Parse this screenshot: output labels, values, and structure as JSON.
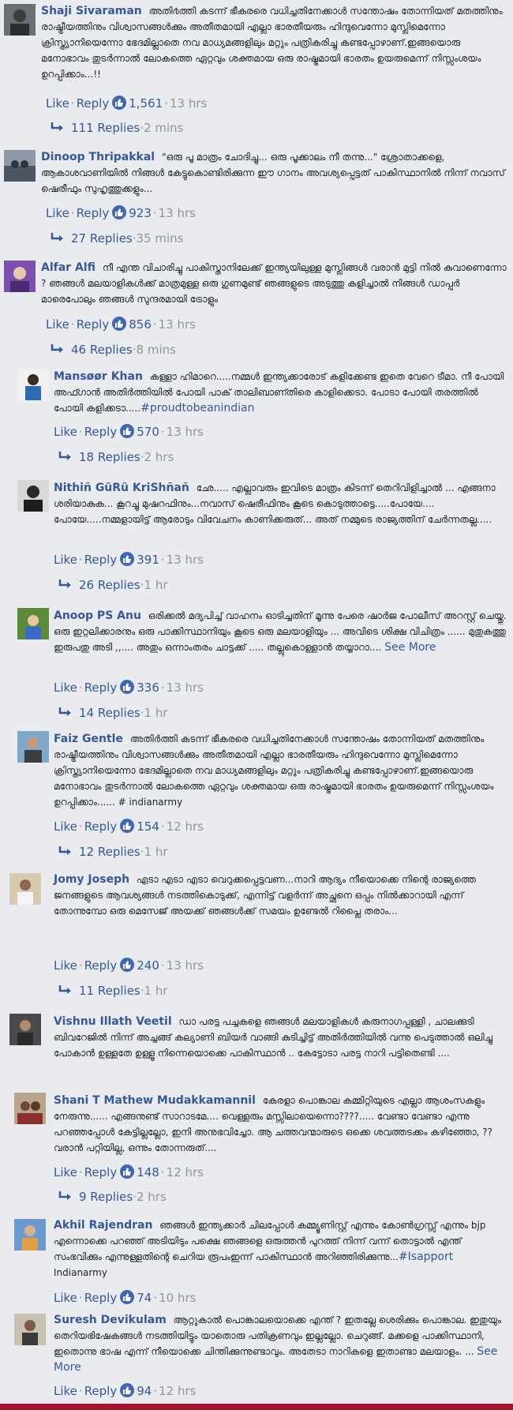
{
  "ui": {
    "like": "Like",
    "reply": "Reply",
    "dot": "·",
    "see_more": "See More"
  },
  "comments": [
    {
      "author": "Shaji Sivaraman",
      "text": "അതി൪ത്തി കടന്ന് ഭീകരരെ വധിച്ചതിനേക്കാൾ സന്തോഷം തോന്നിയത് മതത്തിനും രാഷ്ട്രീയത്തിനും വിശ്വാസങ്ങൾക്കും അതീതമായി എല്ലാ ഭാരതീയരും ഹിന്ദുവെന്നോ മുസ്ലിമെന്നോ ക്രിസ്ത്യാനിയെന്നോ ഭേദമില്ലാതെ നവ മാധ്യമങ്ങളിലും മറ്റും പത്രികരിച്ചു കണ്ടപ്പോഴാണ്.ഇങ്ങയൊരു മനോഭാവം തുടർന്നാൽ ലോകത്തെ ഏറ്റവും ശക്തമായ ഒരു രാഷ്ട്രമായി ഭാരതം ഉയരുമെന്ന് നിസ്സംശയം ഉറപ്പിക്കാം...!!",
      "see_more": "",
      "likes": "1,561",
      "time": "13 hrs",
      "replies": "111 Replies",
      "replies_time": "2 mins"
    },
    {
      "author": "Dinoop Thripakkal",
      "text": "\"ഒരു പൂ മാത്രം ചോദിച്ചു... ഒരു പൂക്കാലം നീ തന്നു...\" ശ്രോതാക്കളെ, ആകാശവാണിയിൽ നിങ്ങൾ കേട്ടുകൊണ്ടിരിക്കുന്ന ഈ ഗാനം അവശ്യപ്പെട്ടത് പാകിസ്ഥാനിൽ നിന്ന് നവാസ് ഷെരീഫും സുഹൃത്തുക്കളും...",
      "see_more": "",
      "likes": "923",
      "time": "13 hrs",
      "replies": "27 Replies",
      "replies_time": "35 mins"
    },
    {
      "author": "Alfar Alfi",
      "text": "നീ എന്ത വിചാരിച്ചു പാകിസ്താനിലേക്ക് ഇന്ത്യയിലുള്ള മുസ്ലിങ്ങൾ വരാൻ മുട്ടി നിൽ കുവാണെന്നോ ? ഞങ്ങൾ മലയാളികൾക്ക് മാത്രമുള്ള ഒരു ഗുണമുണ്ട് ഞങ്ങളുടെ അടുത്തു കളിച്ചാൽ നിങ്ങൾ ഡാപ്പർ മാരെപോലും ഞങ്ങൾ സുന്ദരമായി ട്രോളും",
      "see_more": "",
      "likes": "856",
      "time": "13 hrs",
      "replies": "46 Replies",
      "replies_time": "8 mins"
    },
    {
      "author": "Mansøør Khan",
      "text": "കള്ളാ ഹിമാറെ.....നമ്മൾ ഇന്ത്യക്കാരോട് കളിക്കേണ്ട ഇതെ വേറെ ടീമാ. നീ പോയി അഫ്ഗാൻ അതിർത്തിയിൽ പോയി പാക് താലിബാണ്തിരെ കാളിക്കെടാ. പോടാ പോയി തരത്തിൽ പോയി കളിക്കടാ.....",
      "hashtag": "#proudtobeanindian",
      "see_more": "",
      "likes": "570",
      "time": "13 hrs",
      "replies": "18 Replies",
      "replies_time": "2 hrs"
    },
    {
      "author": "Nithiñ GüRü KriShñañ",
      "text": "ഛേ..... എല്ലാവരും ഇവിടെ മാത്രം കിടന്ന് തെറിവിളിച്ചാൽ ... എങ്ങനാ ശരിയാകുക... കൂറച്ചു മുഷറഫിനും...നവാസ് ഷെരീഫിനും കൂടെ കൊടുത്താട്ടെ.....പോയേ.... പോയേ.....നമ്മളായിട്ട് ആരോടും വിവേചനം കാണിക്കരുത്... അത് നമ്മുടെ രാജ്യത്തിന് ചേർന്നതല്ല.....",
      "see_more": "",
      "likes": "391",
      "time": "13 hrs",
      "replies": "26 Replies",
      "replies_time": "1 hr"
    },
    {
      "author": "Anoop PS Anu",
      "text": "ഒരിക്കൽ മദ്യപിച്ച് വാഹനം ഓടിച്ചതിന് മൂന്നു പേരെ ഷാർജ പോലീസ് അറസ്റ്റ് ചെയ്തു. ഒരു ഇറ്റലിക്കാരനും ഒരു പാക്കിസ്ഥാനിയും കൂടെ ഒരു മലയാളിയും ... അവിടെ ശിക്ഷ വിചിത്രം ...... മുതുകത്തു ഇരുപതു അടി ,,.... അതും ഒന്നാംതരം ചാട്ടക്ക് ..... തല്ലുകൊള്ളാൻ തയ്യാറാ....",
      "see_more": "See More",
      "likes": "336",
      "time": "13 hrs",
      "replies": "14 Replies",
      "replies_time": "1 hr"
    },
    {
      "author": "Faiz Gentle",
      "text": "അതിർത്തി കടന്ന് ഭീകരരെ വധിച്ചതിനേക്കാൾ സന്തോഷം തോന്നിയത് മതത്തിനും രാഷ്ട്രീയത്തിനും വിശ്വാസങ്ങൾക്കും അതീതമായി എല്ലാ ഭാരതീയരും ഹിന്ദുവെന്നോ മുസ്ലിമെന്നോ ക്രിസ്ത്യാനിയെന്നോ ഭേദമില്ലാതെ നവ മാധ്യമങ്ങളിലും മറ്റും പത്രികരിച്ചു കണ്ടപ്പോഴാണ്.ഇങ്ങയൊരു മനോഭാവം തുടർന്നാൽ ലോകത്തെ ഏറ്റവും ശക്തമായ ഒരു രാഷ്ട്രമായി ഭാരതം ഉയരുമെന്ന് നിസ്സംശയം ഉറപ്പിക്കാം...... # indianarmy",
      "see_more": "",
      "likes": "154",
      "time": "12 hrs",
      "replies": "12 Replies",
      "replies_time": "1 hr"
    },
    {
      "author": "Jomy Joseph",
      "text": "എടാ എടാ എടാ വെറുക്കപ്പെട്ടവണ...നാറി ആദ്യം നീയൊക്കെ നിന്റെ രാജ്യത്തെ ജനങ്ങളുടെ ആവശ്യങ്ങൾ നടത്തികൊടുക്ക്, എന്നിട്ട് വളർന്ന് അച്ഛനെ ഒപ്പം നിൽക്കാറായി എന്ന് തോന്നുമ്പോ ഒരു മെസേജ് അയക്ക് ഞങ്ങൾക്ക് സമയം ഉണ്ടേൽ റിപ്ലൈ തരാം...",
      "see_more": "",
      "likes": "240",
      "time": "13 hrs",
      "replies": "11 Replies",
      "replies_time": "1 hr"
    },
    {
      "author": "Vishnu Illath Veetil",
      "text": "ഡാ പരട്ട പച്ചകളെ ഞങ്ങൾ മലയാളികൾ കരുനാഗപ്പള്ളി , ചാലക്കുടി ബിവറേജിൽ നിന്ന് അച്ചങ്ങ് കല്യാണി ബിയർ വാങ്ങി കുടിച്ചിട്ട് അതിർത്തിയിൽ വന്നു പെടുത്താൽ ഒലിച്ചു പോകാൻ ഉള്ളതേ ഉള്ളൂ നിന്നെയൊക്കെ പാകിസ്ഥാൻ .. കേട്ടോടാ പരട്ട നാറി പട്ടിതെണ്ടി ....",
      "see_more": "",
      "likes": "",
      "time": "",
      "replies": "",
      "replies_time": ""
    },
    {
      "author": "Shani T Mathew Mudakkamannil",
      "text": "കേരളാ പൊങ്കാല കമ്മിറ്റിയുടെ എല്ലാ ആശംസകളും നേരുന്നു...... എങ്ങനുണ്ട് സാറാടമേ.... വെള്ളരും മസ്സിലായെന്നൊ????..... വേണ്ടാ വേണ്ടാ എന്നു പറഞ്ഞപ്പോൾ കേട്ടില്ലല്ലോ, ഇനി അനുഭവിച്ചോ. ആ ചത്തവന്മാരുടെ ഒക്കെ ശവത്തടക്കം കഴിഞ്ഞോ, ?? വരാൻ പറ്റിയില്ല, ഒന്നും തോന്നരുത്....",
      "see_more": "",
      "likes": "148",
      "time": "12 hrs",
      "replies": "9 Replies",
      "replies_time": "2 hrs"
    },
    {
      "author": "Akhil Rajendran",
      "text": "ഞങ്ങൾ ഇന്ത്യക്കാർ ചിലപ്പോൾ കമ്മ്യൂണിസ്റ്റ് എന്നും കോൺഗ്രസ്സ് എന്നും bjp എന്നൊക്കെ പറഞ്ഞ് അടിയിടും പക്ഷെ ഞങ്ങളെ ഒരുത്തൻ പുറത്ത് നിന്ന് വന്ന് തൊട്ടാൽ എന്ത് സംഭവിക്കും എന്നുള്ളതിന്റെ ചെറിയ രൂപംഇന്ന് പാകിസ്ഥാൻ അറിഞ്ഞിരിക്കുന്നു...",
      "hashtag": "#Isapport",
      "text_after": "Indianarmy",
      "see_more": "",
      "likes": "74",
      "time": "10 hrs",
      "replies": "",
      "replies_time": ""
    },
    {
      "author": "Suresh Devikulam",
      "text": "ആറ്റുകാൽ പൊങ്കാലയൊക്കെ എന്ത് ? ഇതല്ലേ ശെരിക്കും പൊങ്കാല. ഇതുയും തെറിയഭിഷേകങ്ങൾ നടത്തിയിട്ടും യാതൊരു പതിക്രണവും ഇല്ലല്ലോ. ചെറുങ്ങ്. മക്കളെ പാക്കിസ്ഥാനി, ഇതൊന്നു ഭാഷ എന്ന് നീയൊക്കെ ചിന്തിക്കുന്നുണ്ടാവും. അതേടാ നാറികളെ ഇതാണ്ടാ മലയാളം. ...",
      "see_more": "See More",
      "likes": "94",
      "time": "12 hrs",
      "replies": "",
      "replies_time": ""
    }
  ]
}
